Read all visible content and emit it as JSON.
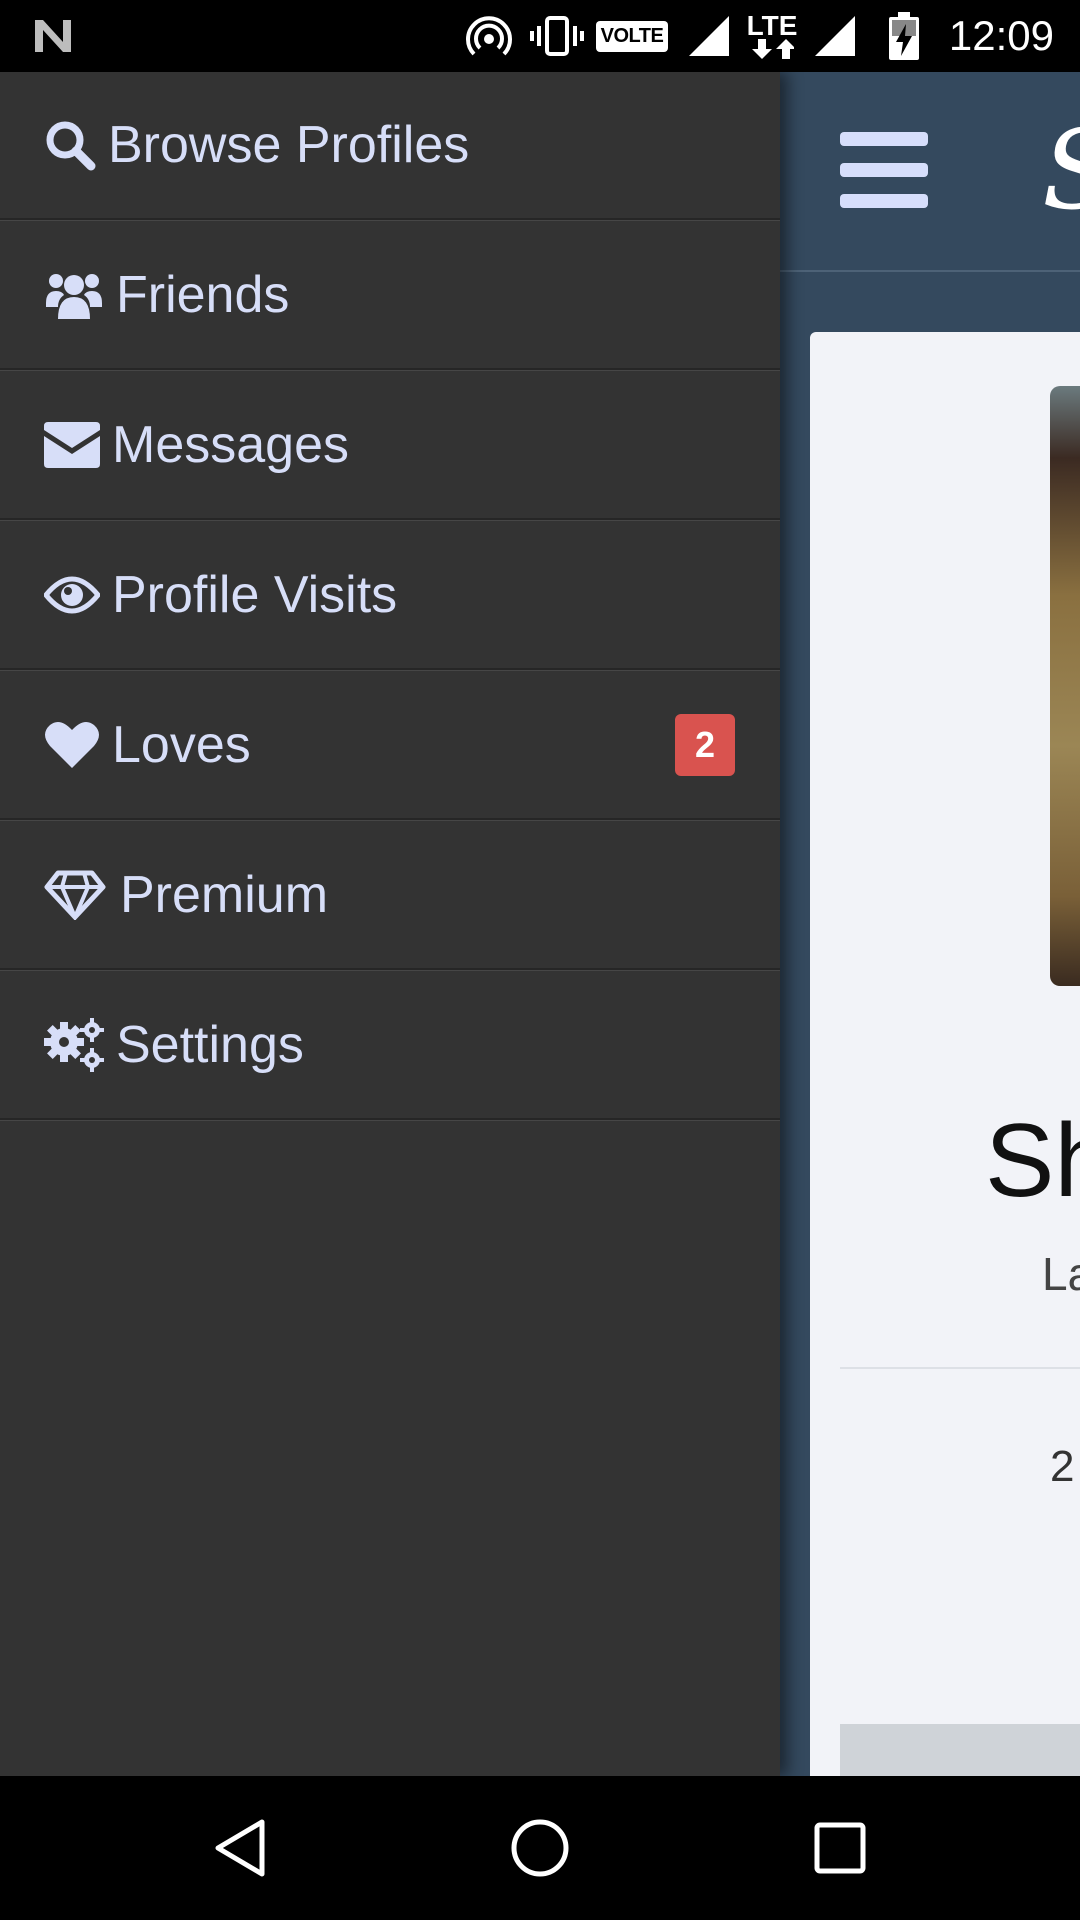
{
  "status_bar": {
    "time": "12:09",
    "volte_label": "VOLTE",
    "lte_label": "LTE",
    "icons": [
      "notification-n-icon",
      "hotspot-icon",
      "vibrate-icon",
      "volte-icon",
      "signal-icon",
      "lte-icon",
      "signal-icon",
      "battery-charging-icon"
    ]
  },
  "drawer": {
    "items": [
      {
        "label": "Browse Profiles",
        "icon": "search-icon"
      },
      {
        "label": "Friends",
        "icon": "users-icon"
      },
      {
        "label": "Messages",
        "icon": "envelope-icon"
      },
      {
        "label": "Profile Visits",
        "icon": "eye-icon"
      },
      {
        "label": "Loves",
        "icon": "heart-icon",
        "badge": "2"
      },
      {
        "label": "Premium",
        "icon": "diamond-icon"
      },
      {
        "label": "Settings",
        "icon": "gears-icon"
      }
    ]
  },
  "app": {
    "logo_partial": "S",
    "profile": {
      "name_partial": "Sh",
      "location_partial": "La",
      "age_partial": "2"
    }
  },
  "nav_bar": {
    "buttons": [
      "back-icon",
      "home-icon",
      "recents-icon"
    ]
  },
  "colors": {
    "drawer_bg": "#333333",
    "drawer_text": "#d7def8",
    "badge": "#d9534f",
    "app_header": "#34495e",
    "card_bg": "#f2f3f8"
  }
}
